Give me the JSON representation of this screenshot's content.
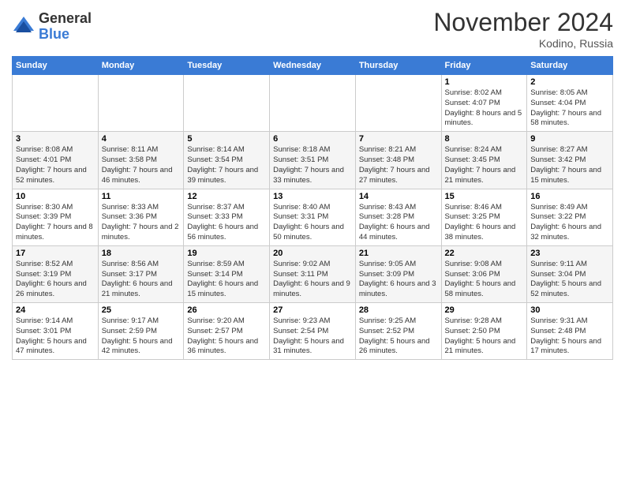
{
  "logo": {
    "general": "General",
    "blue": "Blue"
  },
  "header": {
    "month": "November 2024",
    "location": "Kodino, Russia"
  },
  "weekdays": [
    "Sunday",
    "Monday",
    "Tuesday",
    "Wednesday",
    "Thursday",
    "Friday",
    "Saturday"
  ],
  "weeks": [
    [
      {
        "day": "",
        "info": ""
      },
      {
        "day": "",
        "info": ""
      },
      {
        "day": "",
        "info": ""
      },
      {
        "day": "",
        "info": ""
      },
      {
        "day": "",
        "info": ""
      },
      {
        "day": "1",
        "info": "Sunrise: 8:02 AM\nSunset: 4:07 PM\nDaylight: 8 hours and 5 minutes."
      },
      {
        "day": "2",
        "info": "Sunrise: 8:05 AM\nSunset: 4:04 PM\nDaylight: 7 hours and 58 minutes."
      }
    ],
    [
      {
        "day": "3",
        "info": "Sunrise: 8:08 AM\nSunset: 4:01 PM\nDaylight: 7 hours and 52 minutes."
      },
      {
        "day": "4",
        "info": "Sunrise: 8:11 AM\nSunset: 3:58 PM\nDaylight: 7 hours and 46 minutes."
      },
      {
        "day": "5",
        "info": "Sunrise: 8:14 AM\nSunset: 3:54 PM\nDaylight: 7 hours and 39 minutes."
      },
      {
        "day": "6",
        "info": "Sunrise: 8:18 AM\nSunset: 3:51 PM\nDaylight: 7 hours and 33 minutes."
      },
      {
        "day": "7",
        "info": "Sunrise: 8:21 AM\nSunset: 3:48 PM\nDaylight: 7 hours and 27 minutes."
      },
      {
        "day": "8",
        "info": "Sunrise: 8:24 AM\nSunset: 3:45 PM\nDaylight: 7 hours and 21 minutes."
      },
      {
        "day": "9",
        "info": "Sunrise: 8:27 AM\nSunset: 3:42 PM\nDaylight: 7 hours and 15 minutes."
      }
    ],
    [
      {
        "day": "10",
        "info": "Sunrise: 8:30 AM\nSunset: 3:39 PM\nDaylight: 7 hours and 8 minutes."
      },
      {
        "day": "11",
        "info": "Sunrise: 8:33 AM\nSunset: 3:36 PM\nDaylight: 7 hours and 2 minutes."
      },
      {
        "day": "12",
        "info": "Sunrise: 8:37 AM\nSunset: 3:33 PM\nDaylight: 6 hours and 56 minutes."
      },
      {
        "day": "13",
        "info": "Sunrise: 8:40 AM\nSunset: 3:31 PM\nDaylight: 6 hours and 50 minutes."
      },
      {
        "day": "14",
        "info": "Sunrise: 8:43 AM\nSunset: 3:28 PM\nDaylight: 6 hours and 44 minutes."
      },
      {
        "day": "15",
        "info": "Sunrise: 8:46 AM\nSunset: 3:25 PM\nDaylight: 6 hours and 38 minutes."
      },
      {
        "day": "16",
        "info": "Sunrise: 8:49 AM\nSunset: 3:22 PM\nDaylight: 6 hours and 32 minutes."
      }
    ],
    [
      {
        "day": "17",
        "info": "Sunrise: 8:52 AM\nSunset: 3:19 PM\nDaylight: 6 hours and 26 minutes."
      },
      {
        "day": "18",
        "info": "Sunrise: 8:56 AM\nSunset: 3:17 PM\nDaylight: 6 hours and 21 minutes."
      },
      {
        "day": "19",
        "info": "Sunrise: 8:59 AM\nSunset: 3:14 PM\nDaylight: 6 hours and 15 minutes."
      },
      {
        "day": "20",
        "info": "Sunrise: 9:02 AM\nSunset: 3:11 PM\nDaylight: 6 hours and 9 minutes."
      },
      {
        "day": "21",
        "info": "Sunrise: 9:05 AM\nSunset: 3:09 PM\nDaylight: 6 hours and 3 minutes."
      },
      {
        "day": "22",
        "info": "Sunrise: 9:08 AM\nSunset: 3:06 PM\nDaylight: 5 hours and 58 minutes."
      },
      {
        "day": "23",
        "info": "Sunrise: 9:11 AM\nSunset: 3:04 PM\nDaylight: 5 hours and 52 minutes."
      }
    ],
    [
      {
        "day": "24",
        "info": "Sunrise: 9:14 AM\nSunset: 3:01 PM\nDaylight: 5 hours and 47 minutes."
      },
      {
        "day": "25",
        "info": "Sunrise: 9:17 AM\nSunset: 2:59 PM\nDaylight: 5 hours and 42 minutes."
      },
      {
        "day": "26",
        "info": "Sunrise: 9:20 AM\nSunset: 2:57 PM\nDaylight: 5 hours and 36 minutes."
      },
      {
        "day": "27",
        "info": "Sunrise: 9:23 AM\nSunset: 2:54 PM\nDaylight: 5 hours and 31 minutes."
      },
      {
        "day": "28",
        "info": "Sunrise: 9:25 AM\nSunset: 2:52 PM\nDaylight: 5 hours and 26 minutes."
      },
      {
        "day": "29",
        "info": "Sunrise: 9:28 AM\nSunset: 2:50 PM\nDaylight: 5 hours and 21 minutes."
      },
      {
        "day": "30",
        "info": "Sunrise: 9:31 AM\nSunset: 2:48 PM\nDaylight: 5 hours and 17 minutes."
      }
    ]
  ]
}
